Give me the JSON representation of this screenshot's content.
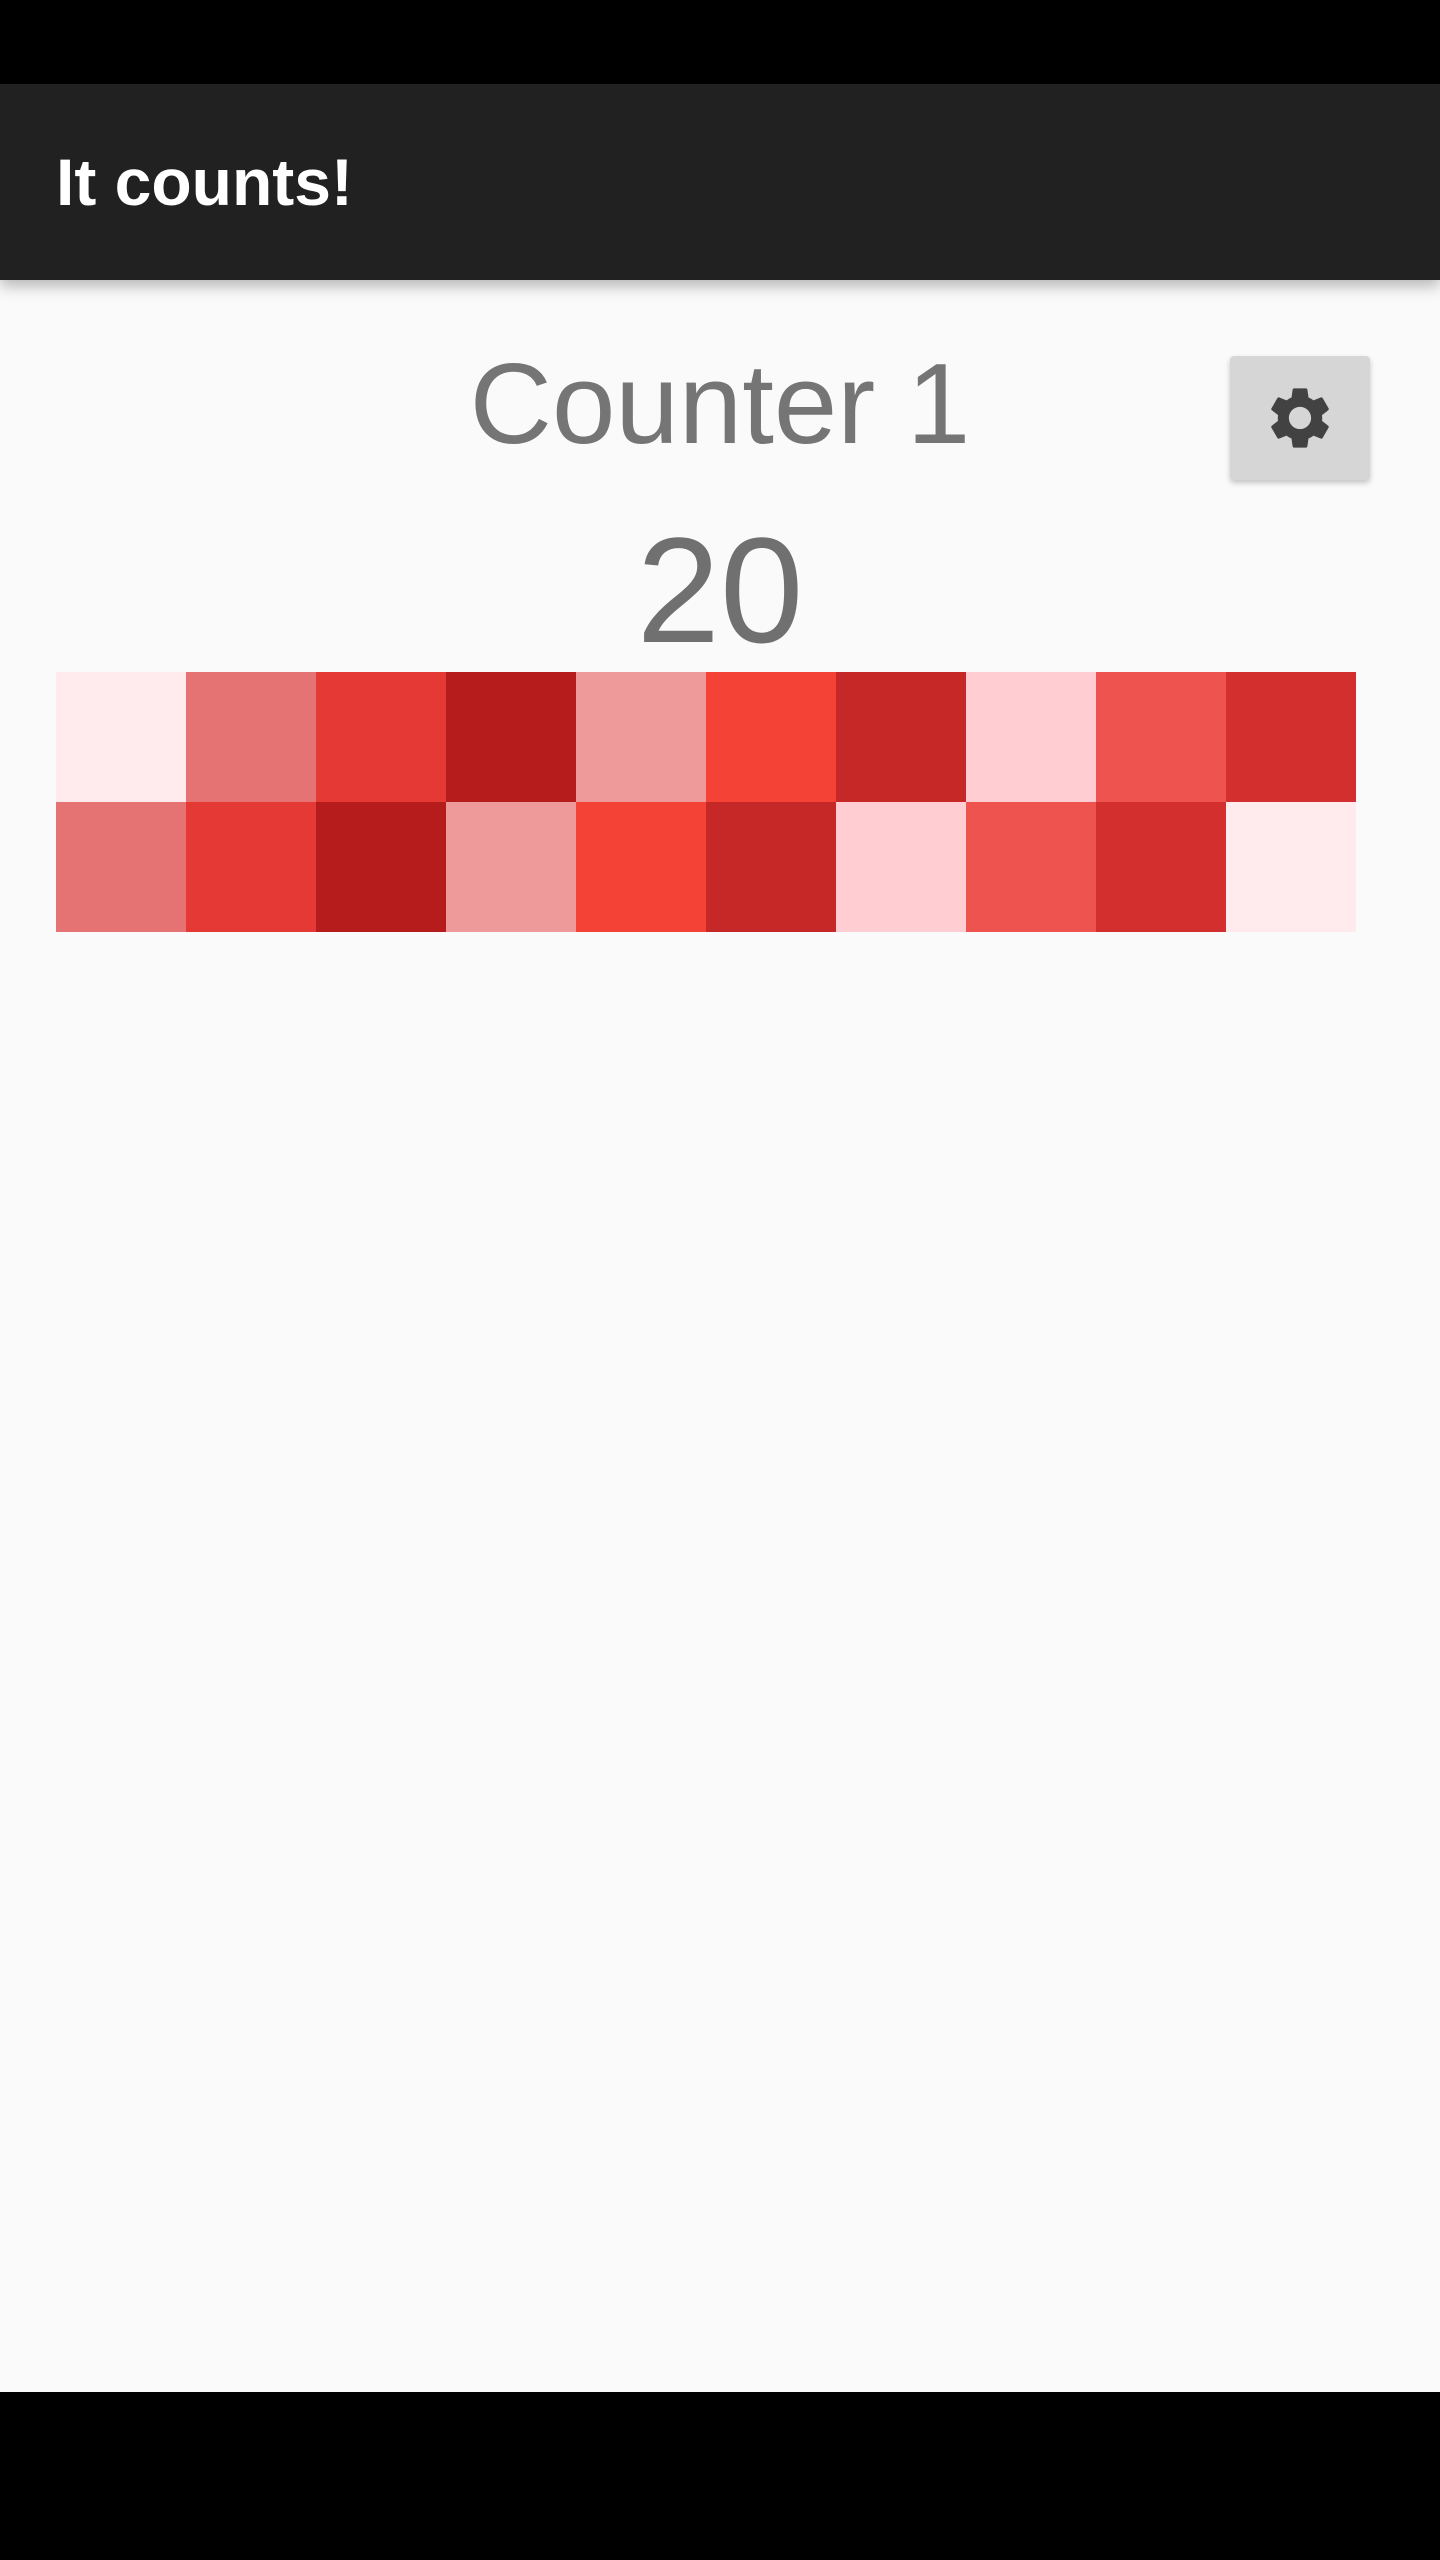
{
  "app_bar": {
    "title": "It counts!"
  },
  "counter": {
    "name": "Counter 1",
    "value": "20"
  },
  "settings_button": {
    "icon": "gear-icon"
  },
  "tiles": {
    "rows": [
      [
        "#ffebee",
        "#e57373",
        "#e53935",
        "#b71c1c",
        "#ef9a9a",
        "#f44336",
        "#c62828",
        "#ffcdd2",
        "#ef5350",
        "#d32f2f"
      ],
      [
        "#e57373",
        "#e53935",
        "#b71c1c",
        "#ef9a9a",
        "#f44336",
        "#c62828",
        "#ffcdd2",
        "#ef5350",
        "#d32f2f",
        "#ffebee"
      ]
    ]
  }
}
